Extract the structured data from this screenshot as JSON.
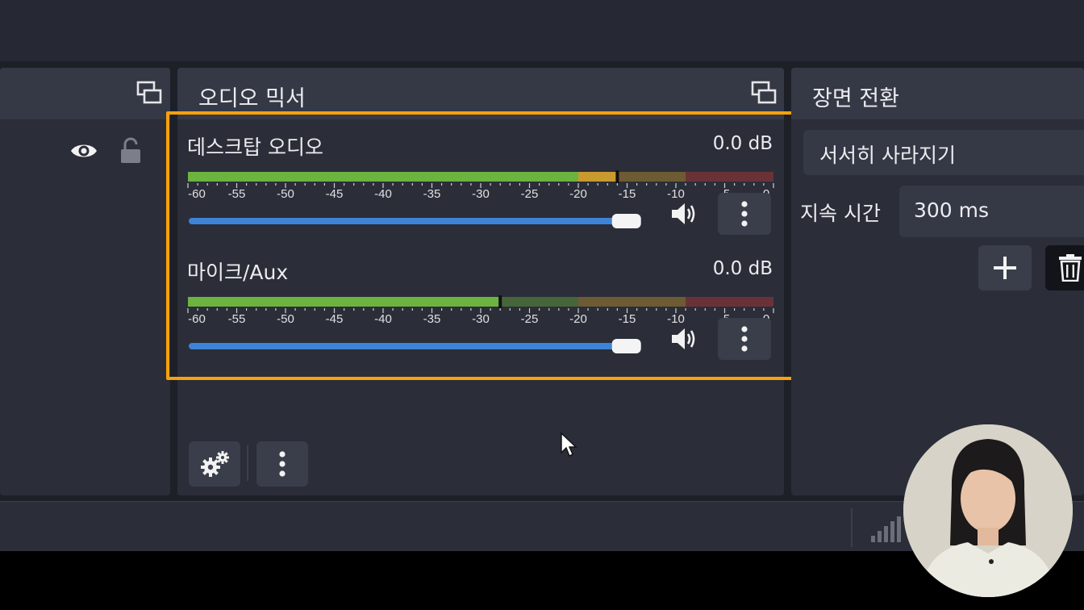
{
  "panels": {
    "mixer_title": "오디오 믹서",
    "transitions_title": "장면 전환"
  },
  "mixer": {
    "tracks": [
      {
        "name": "데스크탑 오디오",
        "db": "0.0 dB",
        "peak_db": -16,
        "volume": 0.96
      },
      {
        "name": "마이크/Aux",
        "db": "0.0 dB",
        "peak_db": -28,
        "volume": 0.96
      }
    ],
    "scale_labels": [
      "-60",
      "-55",
      "-50",
      "-45",
      "-40",
      "-35",
      "-30",
      "-25",
      "-20",
      "-15",
      "-10",
      "-5",
      "0"
    ]
  },
  "transitions": {
    "selected": "서서히 사라지기",
    "duration_label": "지속 시간",
    "duration_value": "300 ms"
  },
  "icons": {
    "undock": "undock-icon",
    "visibility": "eye-icon",
    "lock": "lock-icon",
    "volume": "speaker-icon",
    "menu": "kebab-icon",
    "settings": "gears-icon",
    "add": "plus-icon",
    "delete": "trash-icon",
    "signal": "signal-icon"
  },
  "colors": {
    "highlight": "#f5a10d",
    "fader": "#3d84d6",
    "meter_green": "#6cb33f",
    "meter_yellow": "#c99a2e",
    "meter_red": "#c23a3a"
  }
}
